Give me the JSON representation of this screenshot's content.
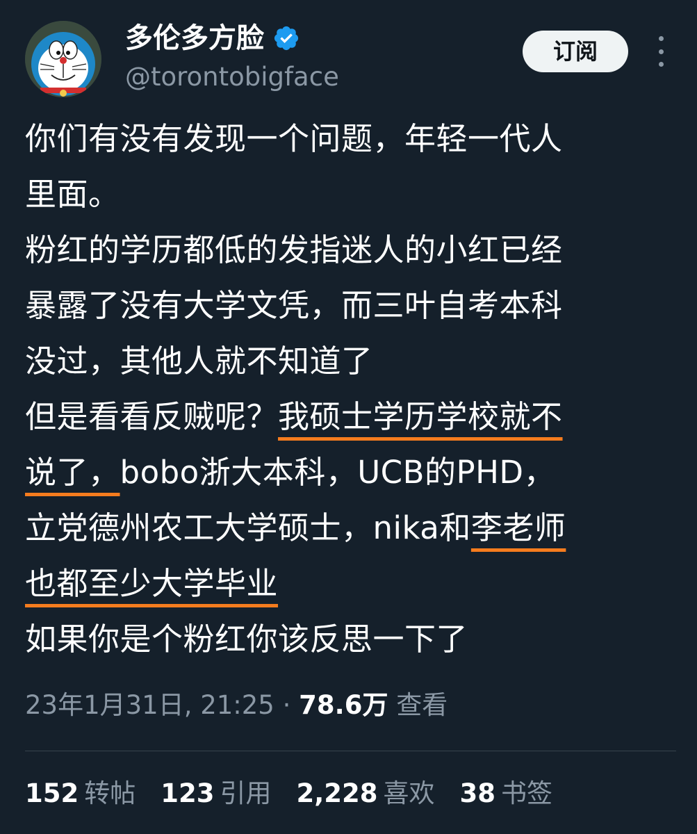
{
  "author": {
    "display_name": "多伦多方脸",
    "handle": "@torontobigface",
    "verified_icon": "verified-badge-icon",
    "avatar_icon": "doraemon-avatar"
  },
  "actions": {
    "subscribe_label": "订阅",
    "more_icon": "more-vertical-icon"
  },
  "tweet": {
    "lines": [
      {
        "plain": "你们有没有发现一个问题，年轻一代人"
      },
      {
        "plain": "里面。"
      },
      {
        "plain": "粉红的学历都低的发指迷人的小红已经"
      },
      {
        "plain": "暴露了没有大学文凭，而三叶自考本科"
      },
      {
        "plain": "没过，其他人就不知道了"
      },
      {
        "plain": "但是看看反贼呢？",
        "underlined": "我硕士学历学校就不"
      },
      {
        "underlined": "说了，",
        "plain": "bobo浙大本科，UCB的PHD，"
      },
      {
        "plain": "立党德州农工大学硕士，nika和",
        "underlined": "李老师"
      },
      {
        "underlined": "也都至少大学毕业"
      },
      {
        "plain": "如果你是个粉红你该反思一下了"
      }
    ],
    "underline_color": "#f57c1e"
  },
  "meta": {
    "timestamp": "23年1月31日, 21:25",
    "separator": "·",
    "views_count": "78.6万",
    "views_label": "查看"
  },
  "stats": {
    "retweets": {
      "count": "152",
      "label": "转帖"
    },
    "quotes": {
      "count": "123",
      "label": "引用"
    },
    "likes": {
      "count": "2,228",
      "label": "喜欢"
    },
    "bookmarks": {
      "count": "38",
      "label": "书签"
    }
  },
  "colors": {
    "background": "#15202b",
    "text_primary": "#ffffff",
    "text_secondary": "#8b98a5",
    "verified_blue": "#1d9bf0",
    "button_bg": "#eff3f4",
    "divider": "#38444d"
  }
}
